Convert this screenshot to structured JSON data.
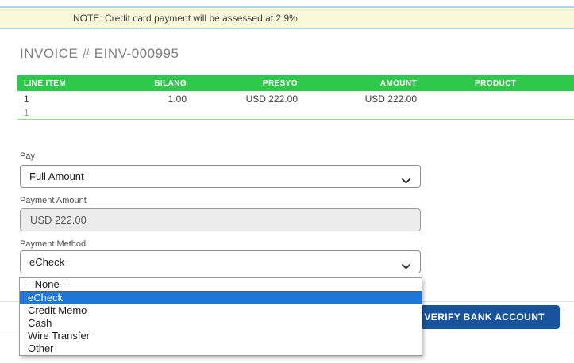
{
  "note": {
    "text": "NOTE: Credit card payment will be assessed at 2.9%"
  },
  "invoice": {
    "title": "INVOICE # EINV-000995"
  },
  "table": {
    "columns": [
      "LINE ITEM",
      "BILANG",
      "PRESYO",
      "AMOUNT",
      "PRODUCT"
    ],
    "rows": [
      {
        "line_item": "1",
        "bilang": "1.00",
        "presyo": "USD 222.00",
        "amount": "USD 222.00",
        "product": ""
      },
      {
        "line_item": "1",
        "bilang": "",
        "presyo": "",
        "amount": "",
        "product": ""
      }
    ]
  },
  "form": {
    "pay": {
      "label": "Pay",
      "value": "Full Amount"
    },
    "payment_amount": {
      "label": "Payment Amount",
      "value": "USD 222.00"
    },
    "payment_method": {
      "label": "Payment Method",
      "value": "eCheck",
      "options": [
        "--None--",
        "eCheck",
        "Credit Memo",
        "Cash",
        "Wire Transfer",
        "Other"
      ],
      "selected_option": "eCheck"
    }
  },
  "footer": {
    "verify_button_label": "VERIFY BANK ACCOUNT"
  },
  "icons": {
    "select_chevron": "chevron-down"
  },
  "colors": {
    "banner_bg": "#fbf7d9",
    "banner_border": "#abd7f1",
    "table_header_green": "#2ec84b",
    "table_underline_green": "#92dc92",
    "highlight_blue": "#1e76d6",
    "button_blue": "#18549d",
    "disabled_input_bg": "#ececec"
  }
}
